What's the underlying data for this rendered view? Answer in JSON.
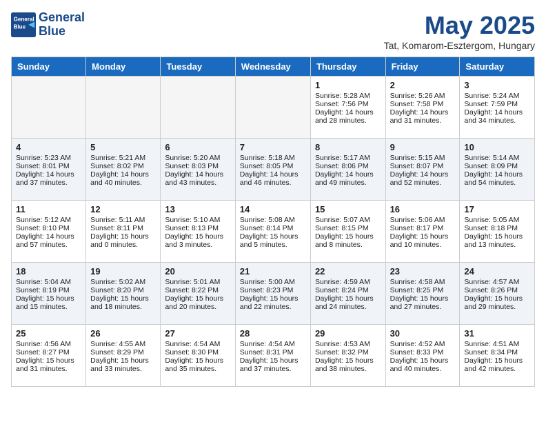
{
  "header": {
    "logo_line1": "General",
    "logo_line2": "Blue",
    "month": "May 2025",
    "location": "Tat, Komarom-Esztergom, Hungary"
  },
  "days_of_week": [
    "Sunday",
    "Monday",
    "Tuesday",
    "Wednesday",
    "Thursday",
    "Friday",
    "Saturday"
  ],
  "weeks": [
    [
      {
        "day": "",
        "text": ""
      },
      {
        "day": "",
        "text": ""
      },
      {
        "day": "",
        "text": ""
      },
      {
        "day": "",
        "text": ""
      },
      {
        "day": "1",
        "text": "Sunrise: 5:28 AM\nSunset: 7:56 PM\nDaylight: 14 hours\nand 28 minutes."
      },
      {
        "day": "2",
        "text": "Sunrise: 5:26 AM\nSunset: 7:58 PM\nDaylight: 14 hours\nand 31 minutes."
      },
      {
        "day": "3",
        "text": "Sunrise: 5:24 AM\nSunset: 7:59 PM\nDaylight: 14 hours\nand 34 minutes."
      }
    ],
    [
      {
        "day": "4",
        "text": "Sunrise: 5:23 AM\nSunset: 8:01 PM\nDaylight: 14 hours\nand 37 minutes."
      },
      {
        "day": "5",
        "text": "Sunrise: 5:21 AM\nSunset: 8:02 PM\nDaylight: 14 hours\nand 40 minutes."
      },
      {
        "day": "6",
        "text": "Sunrise: 5:20 AM\nSunset: 8:03 PM\nDaylight: 14 hours\nand 43 minutes."
      },
      {
        "day": "7",
        "text": "Sunrise: 5:18 AM\nSunset: 8:05 PM\nDaylight: 14 hours\nand 46 minutes."
      },
      {
        "day": "8",
        "text": "Sunrise: 5:17 AM\nSunset: 8:06 PM\nDaylight: 14 hours\nand 49 minutes."
      },
      {
        "day": "9",
        "text": "Sunrise: 5:15 AM\nSunset: 8:07 PM\nDaylight: 14 hours\nand 52 minutes."
      },
      {
        "day": "10",
        "text": "Sunrise: 5:14 AM\nSunset: 8:09 PM\nDaylight: 14 hours\nand 54 minutes."
      }
    ],
    [
      {
        "day": "11",
        "text": "Sunrise: 5:12 AM\nSunset: 8:10 PM\nDaylight: 14 hours\nand 57 minutes."
      },
      {
        "day": "12",
        "text": "Sunrise: 5:11 AM\nSunset: 8:11 PM\nDaylight: 15 hours\nand 0 minutes."
      },
      {
        "day": "13",
        "text": "Sunrise: 5:10 AM\nSunset: 8:13 PM\nDaylight: 15 hours\nand 3 minutes."
      },
      {
        "day": "14",
        "text": "Sunrise: 5:08 AM\nSunset: 8:14 PM\nDaylight: 15 hours\nand 5 minutes."
      },
      {
        "day": "15",
        "text": "Sunrise: 5:07 AM\nSunset: 8:15 PM\nDaylight: 15 hours\nand 8 minutes."
      },
      {
        "day": "16",
        "text": "Sunrise: 5:06 AM\nSunset: 8:17 PM\nDaylight: 15 hours\nand 10 minutes."
      },
      {
        "day": "17",
        "text": "Sunrise: 5:05 AM\nSunset: 8:18 PM\nDaylight: 15 hours\nand 13 minutes."
      }
    ],
    [
      {
        "day": "18",
        "text": "Sunrise: 5:04 AM\nSunset: 8:19 PM\nDaylight: 15 hours\nand 15 minutes."
      },
      {
        "day": "19",
        "text": "Sunrise: 5:02 AM\nSunset: 8:20 PM\nDaylight: 15 hours\nand 18 minutes."
      },
      {
        "day": "20",
        "text": "Sunrise: 5:01 AM\nSunset: 8:22 PM\nDaylight: 15 hours\nand 20 minutes."
      },
      {
        "day": "21",
        "text": "Sunrise: 5:00 AM\nSunset: 8:23 PM\nDaylight: 15 hours\nand 22 minutes."
      },
      {
        "day": "22",
        "text": "Sunrise: 4:59 AM\nSunset: 8:24 PM\nDaylight: 15 hours\nand 24 minutes."
      },
      {
        "day": "23",
        "text": "Sunrise: 4:58 AM\nSunset: 8:25 PM\nDaylight: 15 hours\nand 27 minutes."
      },
      {
        "day": "24",
        "text": "Sunrise: 4:57 AM\nSunset: 8:26 PM\nDaylight: 15 hours\nand 29 minutes."
      }
    ],
    [
      {
        "day": "25",
        "text": "Sunrise: 4:56 AM\nSunset: 8:27 PM\nDaylight: 15 hours\nand 31 minutes."
      },
      {
        "day": "26",
        "text": "Sunrise: 4:55 AM\nSunset: 8:29 PM\nDaylight: 15 hours\nand 33 minutes."
      },
      {
        "day": "27",
        "text": "Sunrise: 4:54 AM\nSunset: 8:30 PM\nDaylight: 15 hours\nand 35 minutes."
      },
      {
        "day": "28",
        "text": "Sunrise: 4:54 AM\nSunset: 8:31 PM\nDaylight: 15 hours\nand 37 minutes."
      },
      {
        "day": "29",
        "text": "Sunrise: 4:53 AM\nSunset: 8:32 PM\nDaylight: 15 hours\nand 38 minutes."
      },
      {
        "day": "30",
        "text": "Sunrise: 4:52 AM\nSunset: 8:33 PM\nDaylight: 15 hours\nand 40 minutes."
      },
      {
        "day": "31",
        "text": "Sunrise: 4:51 AM\nSunset: 8:34 PM\nDaylight: 15 hours\nand 42 minutes."
      }
    ]
  ]
}
